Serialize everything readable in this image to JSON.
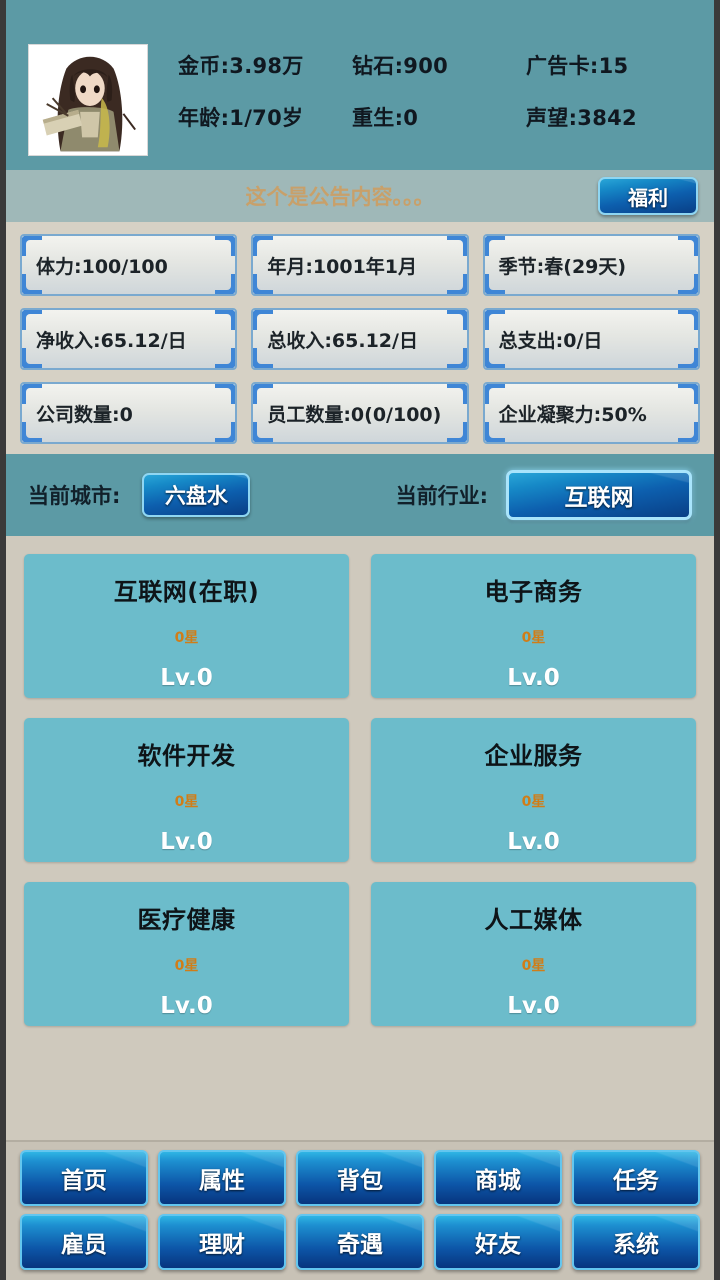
{
  "colors": {
    "teal_header": "#5c9aa5",
    "notice_bar": "#9fb8b8",
    "page_background": "#cfc9bd",
    "stat_panel": "#d6d1c5",
    "card_fill": "#6cbccb",
    "button_blue": "#0d5fae",
    "star_orange": "#d07d18",
    "notice_text": "#c8a06a"
  },
  "header": {
    "avatar_name": "player-avatar",
    "stats": [
      {
        "label": "金币:3.98万"
      },
      {
        "label": "钻石:900"
      },
      {
        "label": "广告卡:15"
      },
      {
        "label": "年龄:1/70岁"
      },
      {
        "label": "重生:0"
      },
      {
        "label": "声望:3842"
      }
    ]
  },
  "notice": {
    "text": "这个是公告内容。。。",
    "welfare_button": "福利"
  },
  "stat_panel": {
    "boxes": [
      {
        "label": "体力:100/100"
      },
      {
        "label": "年月:1001年1月"
      },
      {
        "label": "季节:春(29天)"
      },
      {
        "label": "净收入:65.12/日"
      },
      {
        "label": "总收入:65.12/日"
      },
      {
        "label": "总支出:0/日"
      },
      {
        "label": "公司数量:0"
      },
      {
        "label": "员工数量:0(0/100)"
      },
      {
        "label": "企业凝聚力:50%"
      }
    ]
  },
  "selector": {
    "city_label": "当前城市:",
    "city_value": "六盘水",
    "industry_label": "当前行业:",
    "industry_value": "互联网"
  },
  "industries": {
    "cards": [
      {
        "name": "互联网(在职)",
        "stars": "0星",
        "level": "Lv.0"
      },
      {
        "name": "电子商务",
        "stars": "0星",
        "level": "Lv.0"
      },
      {
        "name": "软件开发",
        "stars": "0星",
        "level": "Lv.0"
      },
      {
        "name": "企业服务",
        "stars": "0星",
        "level": "Lv.0"
      },
      {
        "name": "医疗健康",
        "stars": "0星",
        "level": "Lv.0"
      },
      {
        "name": "人工媒体",
        "stars": "0星",
        "level": "Lv.0"
      }
    ]
  },
  "bottom_nav": {
    "items": [
      {
        "label": "首页"
      },
      {
        "label": "属性"
      },
      {
        "label": "背包"
      },
      {
        "label": "商城"
      },
      {
        "label": "任务"
      },
      {
        "label": "雇员"
      },
      {
        "label": "理财"
      },
      {
        "label": "奇遇"
      },
      {
        "label": "好友"
      },
      {
        "label": "系统"
      }
    ]
  }
}
